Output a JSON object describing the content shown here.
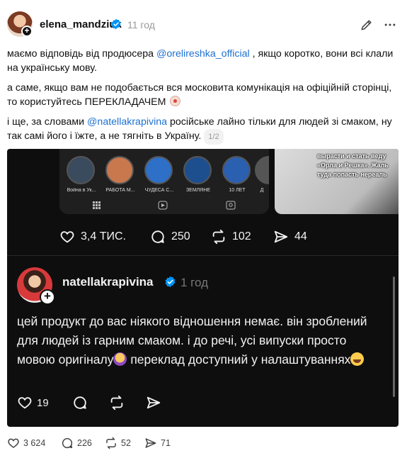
{
  "post": {
    "username": "elena_mandziuk",
    "time": "11 год",
    "paragraphs": {
      "p1_a": "маємо відповідь від продюсера ",
      "p1_mention": "@orelireshka_official",
      "p1_b": " , якщо коротко, вони всі клали на українську мову.",
      "p2": "а саме, якщо вам не подобається вся московита комунікація на офіційній сторінці, то користуйтесь ПЕРЕКЛАДАЧЕМ",
      "p3_a": "і ще, за словами ",
      "p3_mention": "@natellakrapivina",
      "p3_b": " російське лайно тільки для людей зі смаком, ну так самі його і їжте, а не тягніть в Україну.",
      "page_counter": "1/2"
    }
  },
  "embedded": {
    "stories": [
      {
        "label": "Война в Ук..."
      },
      {
        "label": "РАБОТА М..."
      },
      {
        "label": "ЧУДЕСА С..."
      },
      {
        "label": "ЗЕМЛЯНЕ"
      },
      {
        "label": "10 ЛЕТ"
      },
      {
        "label": "Д"
      }
    ],
    "video_caption": {
      "line1": "вырасти и стать веду",
      "line2": "«Орла и Решка». Жаль",
      "line3": "туда попасть нереаль"
    },
    "actions": {
      "likes": "3,4 ТИС.",
      "comments": "250",
      "reposts": "102",
      "shares": "44"
    },
    "reply": {
      "username": "natellakrapivina",
      "time": "1 год",
      "text_a": "цей продукт до вас ніякого відношення немає. він зроблений для людей із гарним смаком. і до речі, усі випуски просто мовою оригіналу",
      "text_b": " переклад доступний у налаштуваннях",
      "likes": "19"
    }
  },
  "footer": {
    "likes": "3 624",
    "comments": "226",
    "reposts": "52",
    "shares": "71"
  },
  "colors": {
    "accent": "#1d71d1",
    "verified": "#0095f6",
    "dark_bg": "#0e0e0e"
  }
}
